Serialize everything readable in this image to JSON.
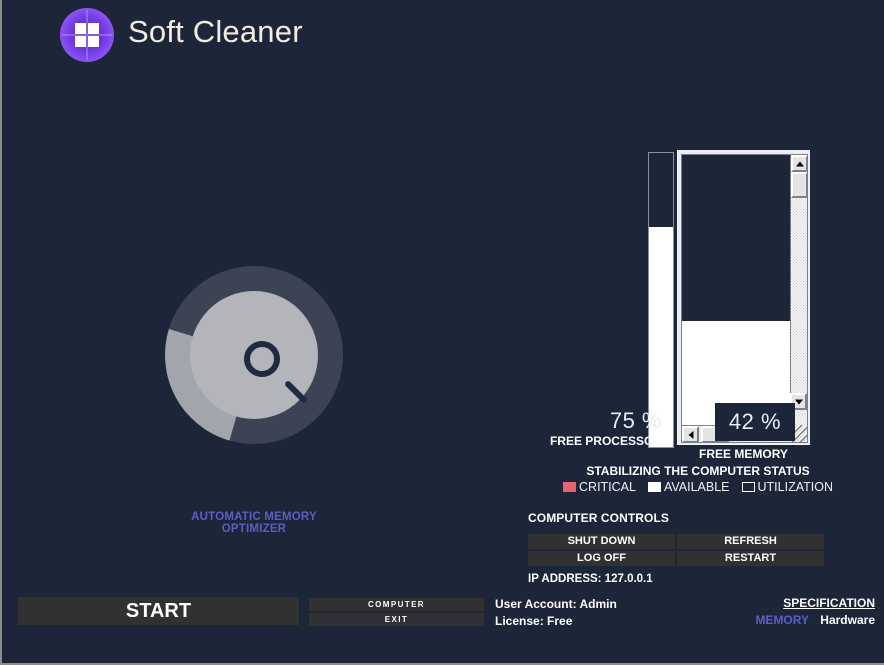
{
  "window": {
    "background_color": "#1d2639",
    "border_color": "#8c8c8c"
  },
  "header": {
    "app_title": "Soft Cleaner",
    "logo_icon": "four-pane-window-icon",
    "logo_color": "#7f46ef"
  },
  "scanner": {
    "icon": "magnifier-icon",
    "ring_base_color": "#3b4355",
    "ring_progress_color": "#a2a5ab",
    "progress_start_deg": 196,
    "progress_end_deg": 287,
    "optimizer_label": "AUTOMATIC MEMORY OPTIMIZER",
    "optimizer_color": "#5a5fc6"
  },
  "gauges": {
    "processor": {
      "value_text": "75 %",
      "label": "FREE PROCESSOR",
      "fill_percent": 75,
      "fill_color": "#ffffff"
    },
    "memory": {
      "value_text": "42 %",
      "label": "FREE MEMORY",
      "fill_percent": 42,
      "fill_color": "#ffffff",
      "scroll_up_icon": "scroll-up-arrow-icon",
      "scroll_down_icon": "scroll-down-arrow-icon",
      "scroll_left_icon": "scroll-left-arrow-icon",
      "resize_grip_icon": "resize-grip-icon"
    }
  },
  "status": {
    "message": "STABILIZING THE COMPUTER STATUS"
  },
  "legend": [
    {
      "label": "CRITICAL",
      "color": "#e8636c",
      "style": "filled"
    },
    {
      "label": "AVAILABLE",
      "color": "#ffffff",
      "style": "filled"
    },
    {
      "label": "UTILIZATION",
      "color": "#ffffff",
      "style": "outline"
    }
  ],
  "controls": {
    "title": "COMPUTER CONTROLS",
    "shut_down": "SHUT DOWN",
    "log_off": "LOG OFF",
    "refresh": "REFRESH",
    "restart": "RESTART"
  },
  "info": {
    "ip_address": "IP ADDRESS: 127.0.0.1",
    "user_account": "User Account: Admin",
    "license": "License: Free"
  },
  "links": {
    "specification": "SPECIFICATION",
    "memory": "MEMORY",
    "hardware": "Hardware"
  },
  "actions": {
    "start": "START",
    "computer": "COMPUTER",
    "exit": "EXIT"
  }
}
